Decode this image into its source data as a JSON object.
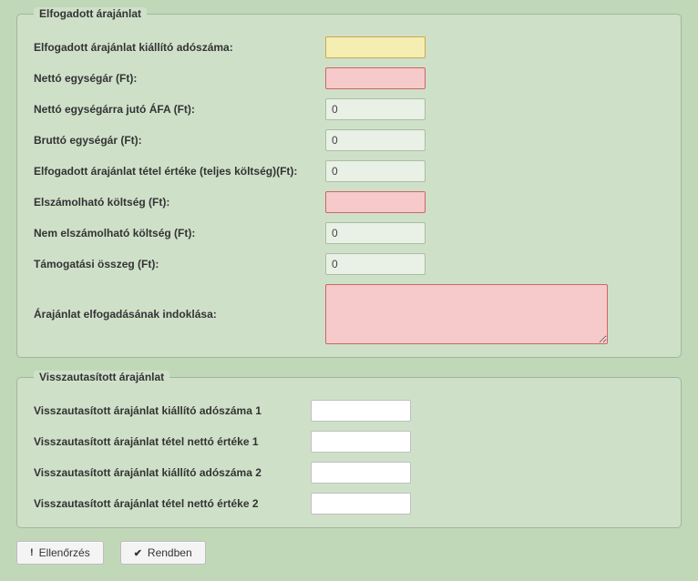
{
  "accepted": {
    "legend": "Elfogadott árajánlat",
    "fields": {
      "tax_number": {
        "label": "Elfogadott árajánlat kiállító adószáma:",
        "value": ""
      },
      "net_unit": {
        "label": "Nettó egységár (Ft):",
        "value": ""
      },
      "net_vat": {
        "label": "Nettó egységárra jutó ÁFA (Ft):",
        "value": "0"
      },
      "gross_unit": {
        "label": "Bruttó egységár (Ft):",
        "value": "0"
      },
      "item_total": {
        "label": "Elfogadott árajánlat tétel értéke (teljes költség)(Ft):",
        "value": "0"
      },
      "eligible_cost": {
        "label": "Elszámolható költség (Ft):",
        "value": ""
      },
      "non_eligible_cost": {
        "label": "Nem elszámolható költség (Ft):",
        "value": "0"
      },
      "grant_amount": {
        "label": "Támogatási összeg (Ft):",
        "value": "0"
      },
      "justification": {
        "label": "Árajánlat elfogadásának indoklása:",
        "value": ""
      }
    }
  },
  "rejected": {
    "legend": "Visszautasított árajánlat",
    "fields": {
      "tax1": {
        "label": "Visszautasított árajánlat kiállító adószáma 1",
        "value": ""
      },
      "net1": {
        "label": "Visszautasított árajánlat tétel nettó értéke 1",
        "value": ""
      },
      "tax2": {
        "label": "Visszautasított árajánlat kiállító adószáma 2",
        "value": ""
      },
      "net2": {
        "label": "Visszautasított árajánlat tétel nettó értéke 2",
        "value": ""
      }
    }
  },
  "buttons": {
    "check": "Ellenőrzés",
    "ok": "Rendben"
  }
}
